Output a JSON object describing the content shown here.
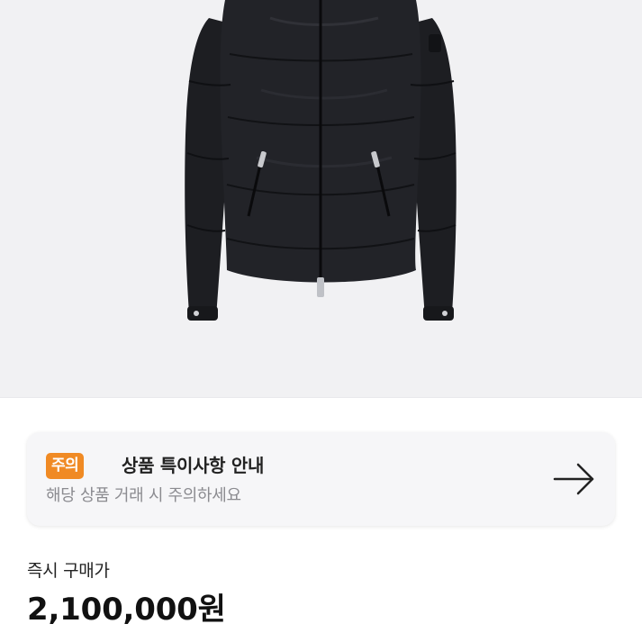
{
  "product": {
    "image_icon": "black-down-jacket-photo"
  },
  "notice": {
    "badge": "주의",
    "title": "상품 특이사항 안내",
    "subtitle": "해당 상품 거래 시 주의하세요",
    "arrow_icon": "arrow-right-icon",
    "badge_color": "#f08a24"
  },
  "price": {
    "label": "즉시 구매가",
    "value": "2,100,000원"
  }
}
